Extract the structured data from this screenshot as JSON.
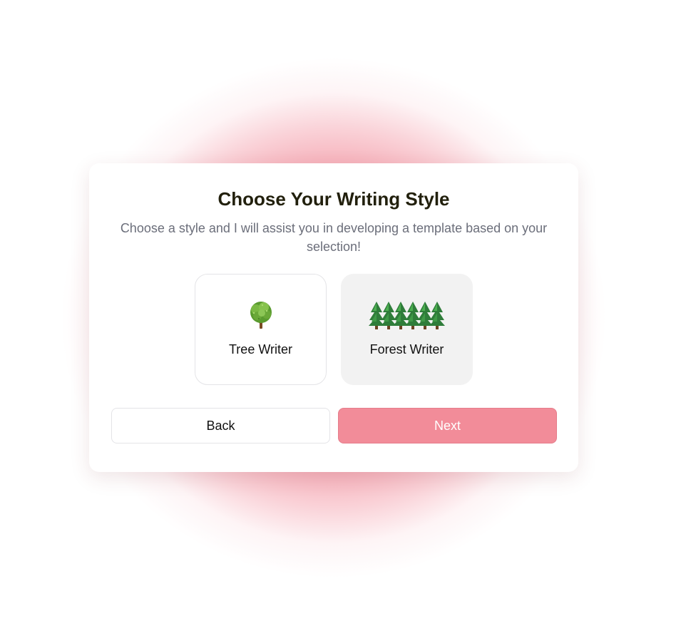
{
  "dialog": {
    "title": "Choose Your Writing Style",
    "subtitle": "Choose a style and I will assist you in developing a template based on your selection!"
  },
  "options": [
    {
      "label": "Tree Writer",
      "icon": "deciduous-tree-icon",
      "selected": false
    },
    {
      "label": "Forest Writer",
      "icon": "evergreen-forest-icon",
      "selected": true
    }
  ],
  "buttons": {
    "back_label": "Back",
    "next_label": "Next"
  },
  "colors": {
    "accent": "#f28c99",
    "title": "#22200d",
    "subtitle": "#6b6e7a",
    "selected_bg": "#f2f2f2",
    "glow": "#e85468"
  }
}
